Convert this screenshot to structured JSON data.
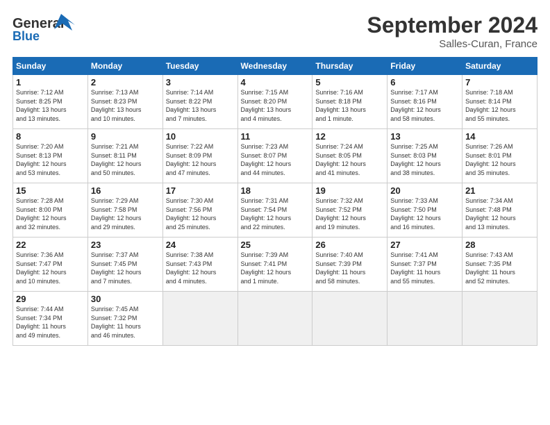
{
  "header": {
    "logo_line1": "General",
    "logo_line2": "Blue",
    "month_title": "September 2024",
    "location": "Salles-Curan, France"
  },
  "weekdays": [
    "Sunday",
    "Monday",
    "Tuesday",
    "Wednesday",
    "Thursday",
    "Friday",
    "Saturday"
  ],
  "weeks": [
    [
      {
        "day": "1",
        "info": "Sunrise: 7:12 AM\nSunset: 8:25 PM\nDaylight: 13 hours\nand 13 minutes."
      },
      {
        "day": "2",
        "info": "Sunrise: 7:13 AM\nSunset: 8:23 PM\nDaylight: 13 hours\nand 10 minutes."
      },
      {
        "day": "3",
        "info": "Sunrise: 7:14 AM\nSunset: 8:22 PM\nDaylight: 13 hours\nand 7 minutes."
      },
      {
        "day": "4",
        "info": "Sunrise: 7:15 AM\nSunset: 8:20 PM\nDaylight: 13 hours\nand 4 minutes."
      },
      {
        "day": "5",
        "info": "Sunrise: 7:16 AM\nSunset: 8:18 PM\nDaylight: 13 hours\nand 1 minute."
      },
      {
        "day": "6",
        "info": "Sunrise: 7:17 AM\nSunset: 8:16 PM\nDaylight: 12 hours\nand 58 minutes."
      },
      {
        "day": "7",
        "info": "Sunrise: 7:18 AM\nSunset: 8:14 PM\nDaylight: 12 hours\nand 55 minutes."
      }
    ],
    [
      {
        "day": "8",
        "info": "Sunrise: 7:20 AM\nSunset: 8:13 PM\nDaylight: 12 hours\nand 53 minutes."
      },
      {
        "day": "9",
        "info": "Sunrise: 7:21 AM\nSunset: 8:11 PM\nDaylight: 12 hours\nand 50 minutes."
      },
      {
        "day": "10",
        "info": "Sunrise: 7:22 AM\nSunset: 8:09 PM\nDaylight: 12 hours\nand 47 minutes."
      },
      {
        "day": "11",
        "info": "Sunrise: 7:23 AM\nSunset: 8:07 PM\nDaylight: 12 hours\nand 44 minutes."
      },
      {
        "day": "12",
        "info": "Sunrise: 7:24 AM\nSunset: 8:05 PM\nDaylight: 12 hours\nand 41 minutes."
      },
      {
        "day": "13",
        "info": "Sunrise: 7:25 AM\nSunset: 8:03 PM\nDaylight: 12 hours\nand 38 minutes."
      },
      {
        "day": "14",
        "info": "Sunrise: 7:26 AM\nSunset: 8:01 PM\nDaylight: 12 hours\nand 35 minutes."
      }
    ],
    [
      {
        "day": "15",
        "info": "Sunrise: 7:28 AM\nSunset: 8:00 PM\nDaylight: 12 hours\nand 32 minutes."
      },
      {
        "day": "16",
        "info": "Sunrise: 7:29 AM\nSunset: 7:58 PM\nDaylight: 12 hours\nand 29 minutes."
      },
      {
        "day": "17",
        "info": "Sunrise: 7:30 AM\nSunset: 7:56 PM\nDaylight: 12 hours\nand 25 minutes."
      },
      {
        "day": "18",
        "info": "Sunrise: 7:31 AM\nSunset: 7:54 PM\nDaylight: 12 hours\nand 22 minutes."
      },
      {
        "day": "19",
        "info": "Sunrise: 7:32 AM\nSunset: 7:52 PM\nDaylight: 12 hours\nand 19 minutes."
      },
      {
        "day": "20",
        "info": "Sunrise: 7:33 AM\nSunset: 7:50 PM\nDaylight: 12 hours\nand 16 minutes."
      },
      {
        "day": "21",
        "info": "Sunrise: 7:34 AM\nSunset: 7:48 PM\nDaylight: 12 hours\nand 13 minutes."
      }
    ],
    [
      {
        "day": "22",
        "info": "Sunrise: 7:36 AM\nSunset: 7:47 PM\nDaylight: 12 hours\nand 10 minutes."
      },
      {
        "day": "23",
        "info": "Sunrise: 7:37 AM\nSunset: 7:45 PM\nDaylight: 12 hours\nand 7 minutes."
      },
      {
        "day": "24",
        "info": "Sunrise: 7:38 AM\nSunset: 7:43 PM\nDaylight: 12 hours\nand 4 minutes."
      },
      {
        "day": "25",
        "info": "Sunrise: 7:39 AM\nSunset: 7:41 PM\nDaylight: 12 hours\nand 1 minute."
      },
      {
        "day": "26",
        "info": "Sunrise: 7:40 AM\nSunset: 7:39 PM\nDaylight: 11 hours\nand 58 minutes."
      },
      {
        "day": "27",
        "info": "Sunrise: 7:41 AM\nSunset: 7:37 PM\nDaylight: 11 hours\nand 55 minutes."
      },
      {
        "day": "28",
        "info": "Sunrise: 7:43 AM\nSunset: 7:35 PM\nDaylight: 11 hours\nand 52 minutes."
      }
    ],
    [
      {
        "day": "29",
        "info": "Sunrise: 7:44 AM\nSunset: 7:34 PM\nDaylight: 11 hours\nand 49 minutes."
      },
      {
        "day": "30",
        "info": "Sunrise: 7:45 AM\nSunset: 7:32 PM\nDaylight: 11 hours\nand 46 minutes."
      },
      {
        "day": "",
        "info": ""
      },
      {
        "day": "",
        "info": ""
      },
      {
        "day": "",
        "info": ""
      },
      {
        "day": "",
        "info": ""
      },
      {
        "day": "",
        "info": ""
      }
    ]
  ]
}
